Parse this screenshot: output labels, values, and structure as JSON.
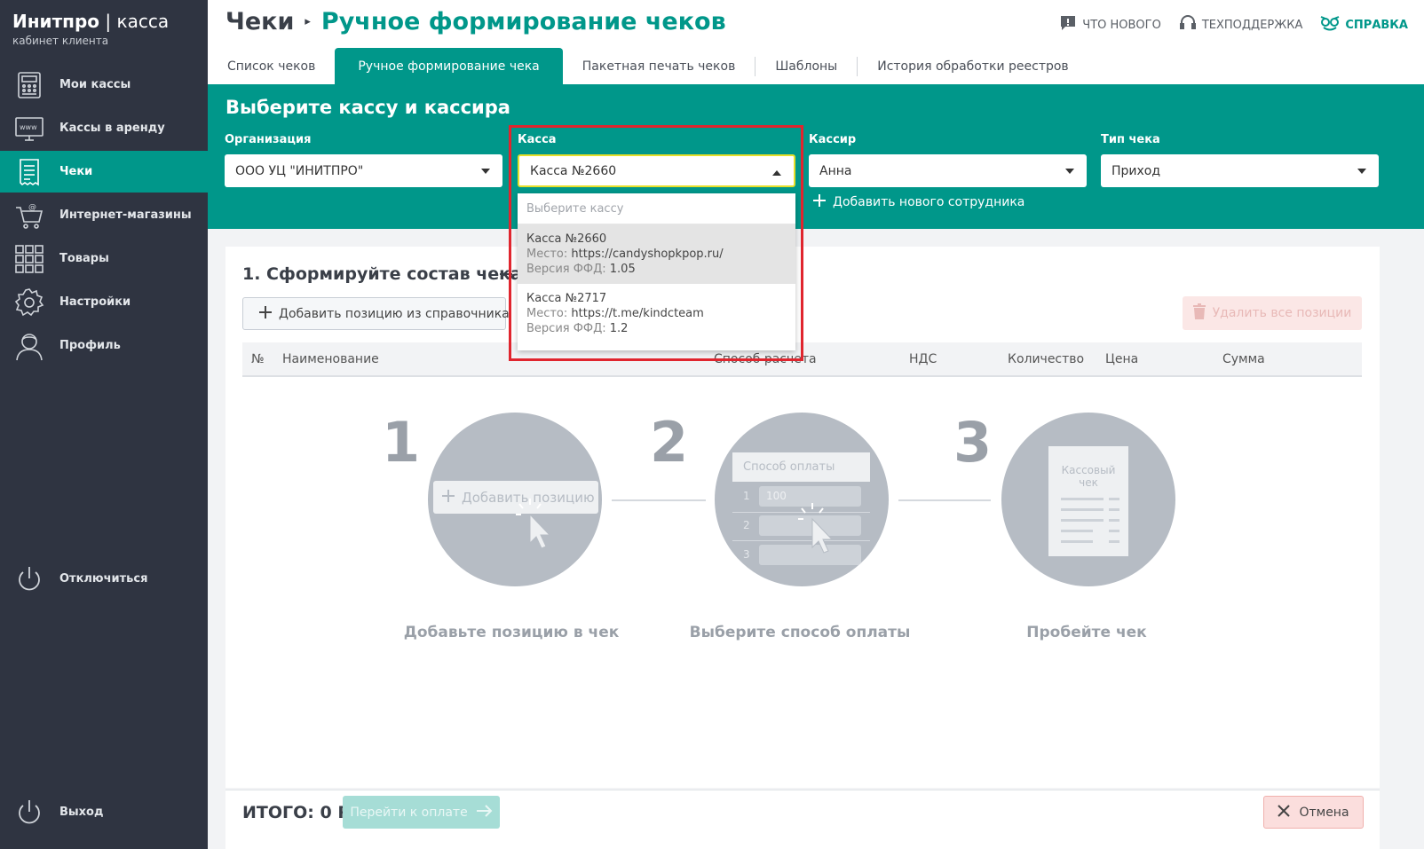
{
  "brand": {
    "name_bold": "Инитпро",
    "separator": " | ",
    "name_thin": "касса",
    "subtitle": "кабинет клиента"
  },
  "sidebar": {
    "items": [
      {
        "label": "Мои кассы",
        "icon": "cash-register-icon"
      },
      {
        "label": "Кассы в аренду",
        "icon": "www-monitor-icon"
      },
      {
        "label": "Чеки",
        "icon": "receipt-icon",
        "active": true
      },
      {
        "label": "Интернет-магазины",
        "icon": "shopping-cart-icon"
      },
      {
        "label": "Товары",
        "icon": "grid-icon"
      },
      {
        "label": "Настройки",
        "icon": "gear-icon"
      },
      {
        "label": "Профиль",
        "icon": "user-icon"
      }
    ],
    "disconnect": "Отключиться",
    "logout": "Выход"
  },
  "header": {
    "breadcrumb": "Чеки",
    "title": "Ручное формирование чеков",
    "links": {
      "news": "ЧТО НОВОГО",
      "support": "ТЕХПОДДЕРЖКА",
      "help": "СПРАВКА"
    }
  },
  "tabs": [
    {
      "label": "Список чеков"
    },
    {
      "label": "Ручное формирование чека",
      "active": true
    },
    {
      "label": "Пакетная печать чеков"
    },
    {
      "label": "Шаблоны"
    },
    {
      "label": "История обработки реестров"
    }
  ],
  "select_panel": {
    "title": "Выберите кассу и кассира",
    "organization": {
      "label": "Организация",
      "value": "ООО УЦ \"ИНИТПРО\""
    },
    "kassa": {
      "label": "Касса",
      "value": "Касса №2660"
    },
    "cashier": {
      "label": "Кассир",
      "value": "Анна"
    },
    "receipt_type": {
      "label": "Тип чека",
      "value": "Приход"
    },
    "add_employee": "Добавить нового сотрудника"
  },
  "dropdown": {
    "placeholder": "Выберите кассу",
    "place_label": "Место:",
    "ffd_label": "Версия ФФД:",
    "options": [
      {
        "name": "Касса №2660",
        "place": "https://candyshopkpop.ru/",
        "ffd": "1.05",
        "selected": true
      },
      {
        "name": "Касса №2717",
        "place": "https://t.me/kindcteam",
        "ffd": "1.2"
      }
    ]
  },
  "composition": {
    "title": "1. Сформируйте состав чека",
    "add_from_catalog": "Добавить позицию из справочника",
    "delete_all": "Удалить все позиции",
    "columns": {
      "num": "№",
      "name": "Наименование",
      "payment_method": "Способ расчета",
      "vat": "НДС",
      "quantity": "Количество",
      "price": "Цена",
      "sum": "Сумма"
    }
  },
  "steps": [
    {
      "num": "1",
      "label": "Добавьте позицию в чек",
      "illustration_text": "Добавить позицию"
    },
    {
      "num": "2",
      "label": "Выберите способ оплаты",
      "illustration_title": "Способ оплаты",
      "illustration_value": "100",
      "rows": [
        "1",
        "2",
        "3"
      ]
    },
    {
      "num": "3",
      "label": "Пробейте чек",
      "illustration_text": "Кассовый чек"
    }
  ],
  "footer": {
    "total": "ИТОГО: 0 Р",
    "pay_button": "Перейти к оплате",
    "cancel_button": "Отмена"
  },
  "colors": {
    "accent": "#00978a",
    "sidebar": "#2f3441",
    "highlight": "#e0252e"
  }
}
